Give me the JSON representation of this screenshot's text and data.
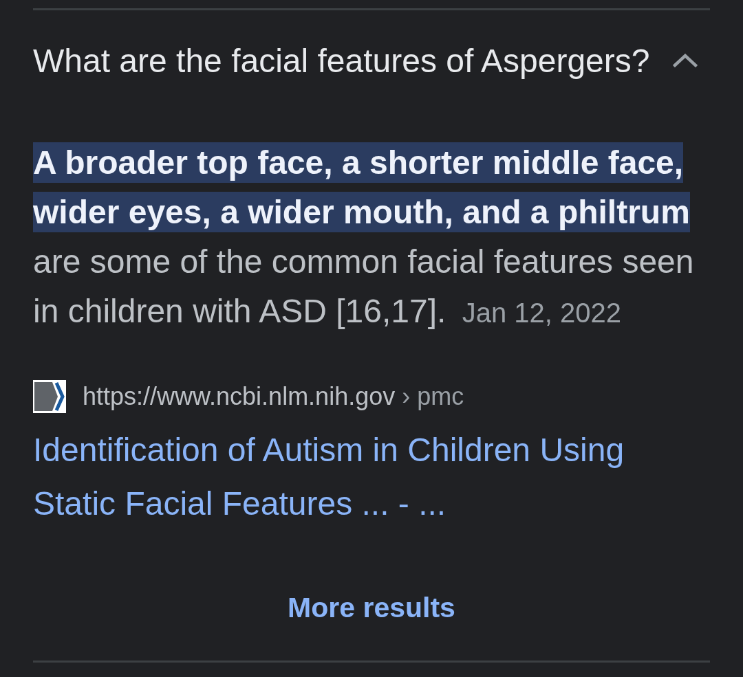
{
  "question": {
    "text": "What are the facial features of Aspergers?",
    "expanded": true
  },
  "answer": {
    "text": "**A broader top face, a shorter middle face, wider eyes, a wider mouth, and a philtrum** are some of the common facial features seen in children with ASD [16,17].",
    "date": "Jan 12, 2022"
  },
  "source": {
    "url": "https://www.ncbi.nlm.nih.gov",
    "path": "› pmc",
    "title": "Identification of Autism in Children Using Static Facial Features ... - ..."
  },
  "more_results": {
    "label": "More results"
  }
}
